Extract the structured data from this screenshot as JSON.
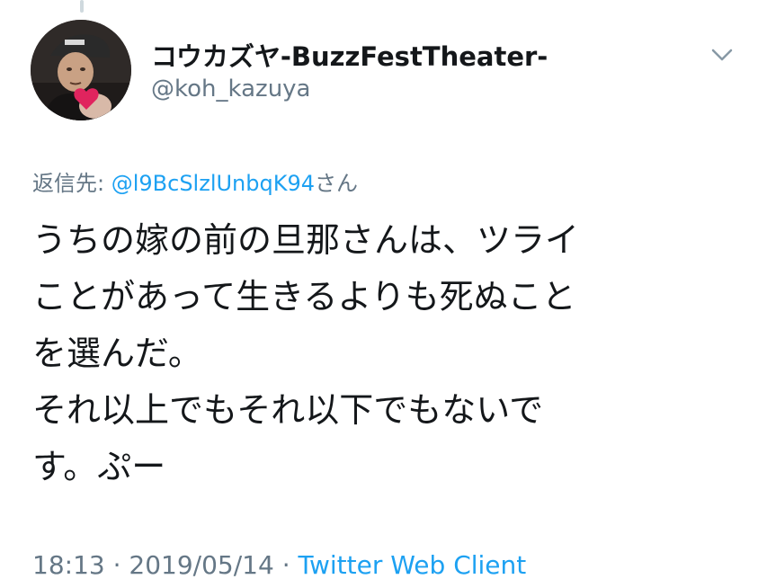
{
  "tweet": {
    "display_name": "コウカズヤ-BuzzFestTheater-",
    "handle": "@koh_kazuya",
    "reply_prefix": "返信先: ",
    "reply_mention": "@l9BcSlzlUnbqK94",
    "reply_suffix": "さん",
    "text_lines": [
      "うちの嫁の前の旦那さんは、ツライ",
      "ことがあって生きるよりも死ぬこと",
      "を選んだ。",
      "それ以上でもそれ以下でもないで",
      "す。ぷー"
    ],
    "time": "18:13",
    "separator": " · ",
    "date": "2019/05/14",
    "client": "Twitter Web Client"
  },
  "icons": {
    "menu": "chevron-down-icon",
    "avatar": "user-avatar-photo"
  },
  "colors": {
    "text": "#14171a",
    "secondary": "#657786",
    "link": "#1da1f2",
    "heart": "#e0245e"
  }
}
